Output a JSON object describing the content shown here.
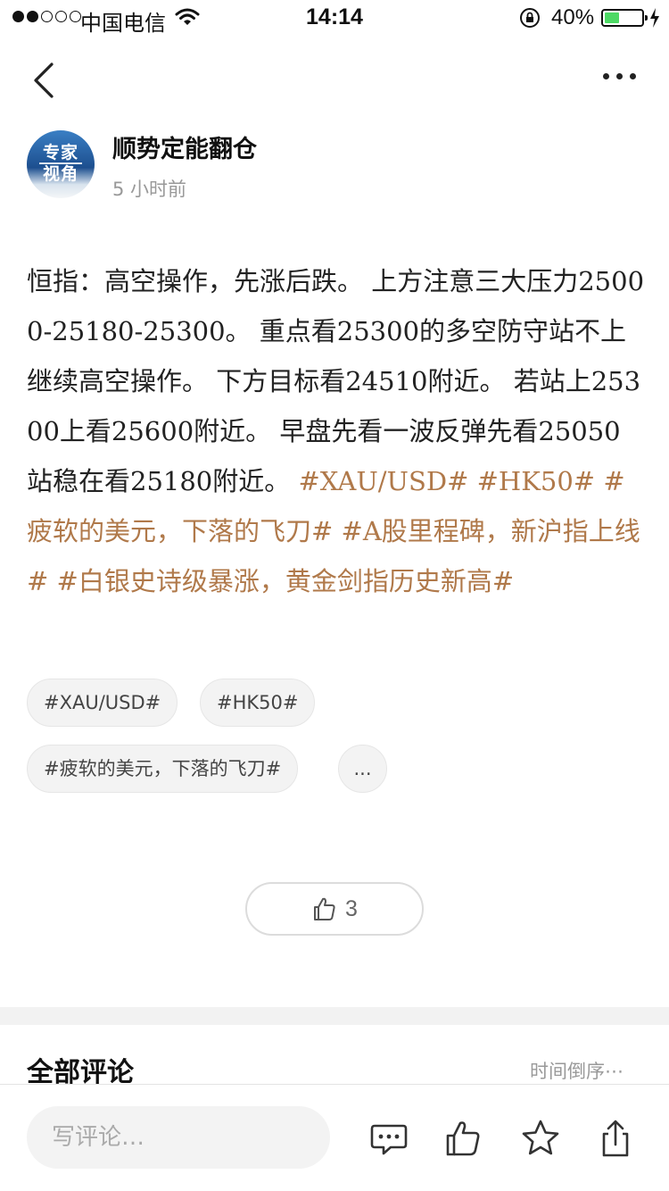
{
  "status_bar": {
    "carrier": "中国电信",
    "time": "14:14",
    "battery": "40%",
    "battery_level": 0.4,
    "signal_bars": [
      1,
      1,
      0,
      0,
      0
    ]
  },
  "icons": {
    "back": "chevron-left-icon",
    "more": "more-dots-icon",
    "like": "thumbs-up-icon",
    "comment": "comment-bubble-icon",
    "favorite": "star-icon",
    "share": "share-icon"
  },
  "author": {
    "name": "顺势定能翻仓",
    "time": "5 小时前",
    "avatar_line1": "专家",
    "avatar_line2": "视角"
  },
  "post": {
    "text": "恒指：高空操作，先涨后跌。 上方注意三大压力25000-25180-25300。 重点看25300的多空防守站不上继续高空操作。 下方目标看24510附近。 若站上25300上看25600附近。 早盘先看一波反弹先看25050站稳在看25180附近。",
    "tags": [
      "#XAU/USD#",
      "#HK50#",
      "#疲软的美元，下落的飞刀#",
      "#A股里程碑，新沪指上线#",
      "#白银史诗级暴涨，黄金剑指历史新高#"
    ]
  },
  "chips": [
    "#XAU/USD#",
    "#HK50#",
    "#疲软的美元，下落的飞刀#",
    "..."
  ],
  "likes": {
    "count": "3"
  },
  "comments": {
    "title": "全部评论",
    "sort": "时间倒序⋯"
  },
  "bottom_bar": {
    "input_placeholder": "写评论…"
  },
  "colors": {
    "tag": "#b0794a",
    "battery": "#4cd964"
  }
}
